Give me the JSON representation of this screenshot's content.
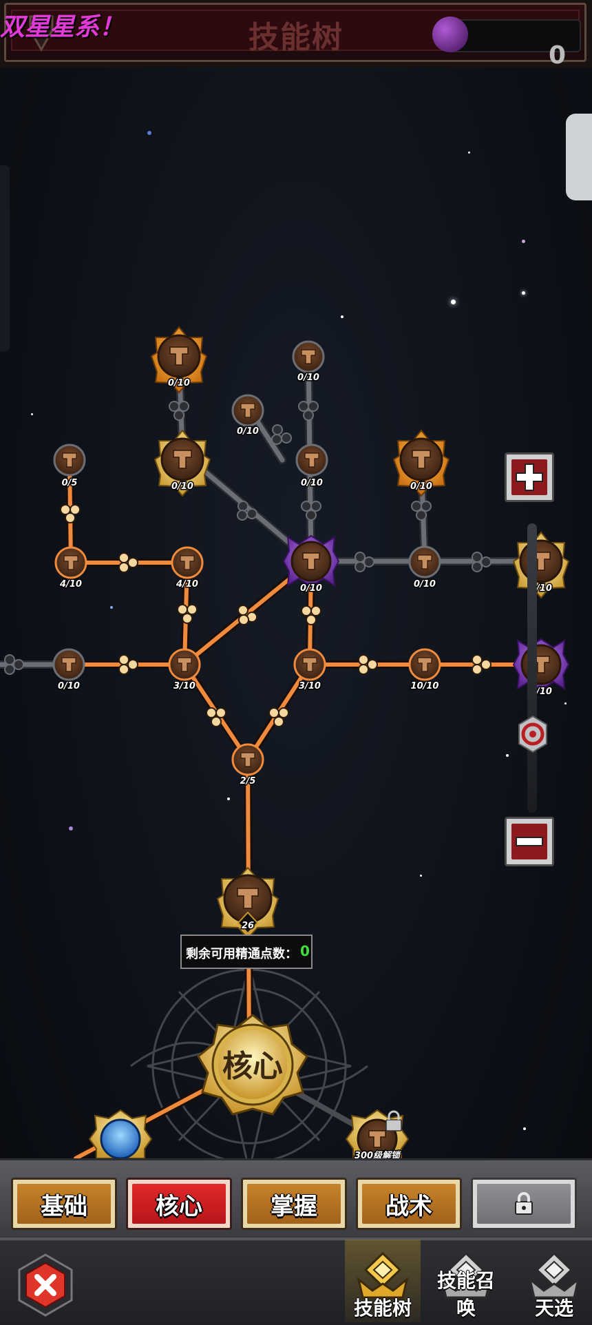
{
  "header": {
    "title": "技能树",
    "marquee": "双星星系！",
    "currency_value": "0"
  },
  "tree": {
    "nodes": [
      {
        "id": "n1",
        "level": "0/10"
      },
      {
        "id": "n2",
        "level": "0/10"
      },
      {
        "id": "n3",
        "level": "0/10"
      },
      {
        "id": "n4",
        "level": "0/5"
      },
      {
        "id": "n5",
        "level": "0/10"
      },
      {
        "id": "n6",
        "level": "0/10"
      },
      {
        "id": "n7",
        "level": "0/10"
      },
      {
        "id": "n8",
        "level": "4/10"
      },
      {
        "id": "n9",
        "level": "4/10"
      },
      {
        "id": "n10",
        "level": "0/10"
      },
      {
        "id": "n11",
        "level": "0/10"
      },
      {
        "id": "n12",
        "level": "0/10"
      },
      {
        "id": "n13",
        "level": "0/10"
      },
      {
        "id": "n14",
        "level": "3/10"
      },
      {
        "id": "n15",
        "level": "3/10"
      },
      {
        "id": "n16",
        "level": "10/10"
      },
      {
        "id": "n17",
        "level": "0/10"
      },
      {
        "id": "n18",
        "level": "2/5"
      },
      {
        "id": "n19",
        "level": "26"
      }
    ],
    "core_label": "核心",
    "remaining_points_label": "剩余可用精通点数：",
    "remaining_points_value": "0",
    "locked_node_caption": "300级解锁"
  },
  "zoom": {
    "in_icon": "plus-icon",
    "out_icon": "minus-icon",
    "handle_icon": "target-icon"
  },
  "categories": {
    "basic": "基础",
    "core": "核心",
    "mastery": "掌握",
    "tactics": "战术",
    "locked_icon": "lock-icon",
    "active": "核心"
  },
  "nav": {
    "skill_tree": "技能树",
    "skill_summon": "技能召唤",
    "chosen": "天选",
    "close_icon": "close-icon"
  },
  "colors": {
    "path_active": "#f08a3c",
    "path_inactive": "#6b6f75",
    "node_gold": "#e8c25a",
    "node_purple": "#8b3fc4",
    "node_orange": "#e7932a",
    "tab_active": "#d61f24",
    "tab_normal": "#b5701f",
    "points_value": "#3fe03c"
  }
}
